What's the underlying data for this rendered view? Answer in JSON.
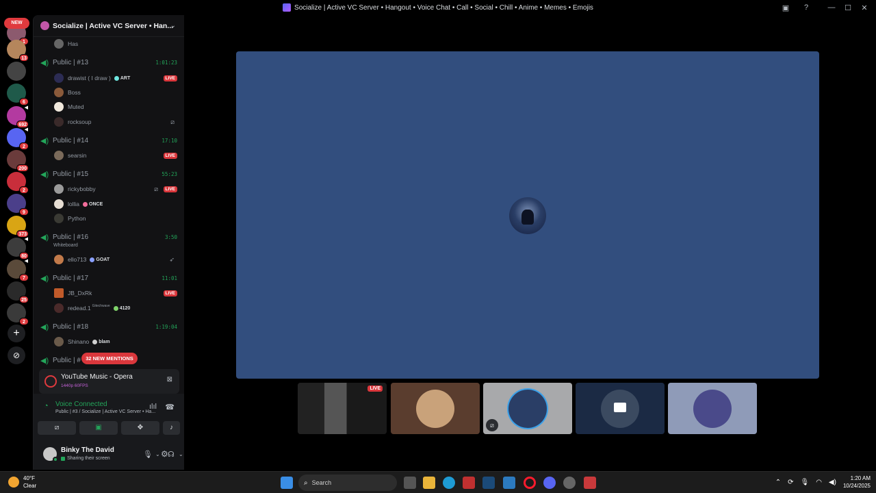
{
  "window": {
    "title": "Socialize | Active VC Server • Hangout • Voice Chat • Call • Social • Chill • Anime • Memes • Emojis",
    "min_glyph": "—",
    "max_glyph": "☐",
    "close_glyph": "✕"
  },
  "rail": {
    "new_label": "NEW",
    "badges": [
      "1",
      "13",
      "6",
      "692",
      "2",
      "200",
      "2",
      "9",
      "373",
      "80",
      "7",
      "25",
      "2"
    ],
    "add_glyph": "+",
    "discover_glyph": "⊘"
  },
  "server": {
    "name": "Socialize | Active VC Server • Han...",
    "chevron": "⌄"
  },
  "voice_channels": [
    {
      "name": "Public | #13",
      "time": "1:01:23"
    },
    {
      "name": "Public | #14",
      "time": "17:10"
    },
    {
      "name": "Public | #15",
      "time": "55:23"
    },
    {
      "name": "Public | #16",
      "time": "3:50",
      "sub": "Whiteboard"
    },
    {
      "name": "Public | #17",
      "time": "11:01"
    },
    {
      "name": "Public | #18",
      "time": "1:19:04"
    },
    {
      "name": "Public | #"
    }
  ],
  "users": [
    {
      "name": "Has"
    },
    {
      "name": "drawist ( I draw )",
      "tag": "ART",
      "live": "LIVE"
    },
    {
      "name": "Boss"
    },
    {
      "name": "Muted"
    },
    {
      "name": "rocksoup"
    },
    {
      "name": "searsin",
      "live": "LIVE"
    },
    {
      "name": "rickybobby",
      "live": "LIVE"
    },
    {
      "name": "lollia",
      "tag": "ONCE"
    },
    {
      "name": "Python"
    },
    {
      "name": "ello713",
      "tag": "GOAT"
    },
    {
      "name": "JB_DxRk",
      "live": "LIVE"
    },
    {
      "name": "redead.1",
      "sub": "Gitechwave",
      "tag": "4120"
    },
    {
      "name": "Shinano",
      "tag": "blam"
    }
  ],
  "mentions": "32 NEW MENTIONS",
  "now_playing": {
    "name": "YouTube Music - Opera",
    "sub": "1440p 60FPS"
  },
  "voice": {
    "status": "Voice Connected",
    "location": "Public | #3 / Socialize | Active VC Server • Ha..."
  },
  "user": {
    "name": "Binky The David",
    "status": "Sharing their screen"
  },
  "tiles": {
    "live_label": "LIVE"
  },
  "taskbar": {
    "temp": "40°F",
    "condition": "Clear",
    "search": "Search",
    "time": "1:20 AM",
    "date": "10/24/2025"
  }
}
